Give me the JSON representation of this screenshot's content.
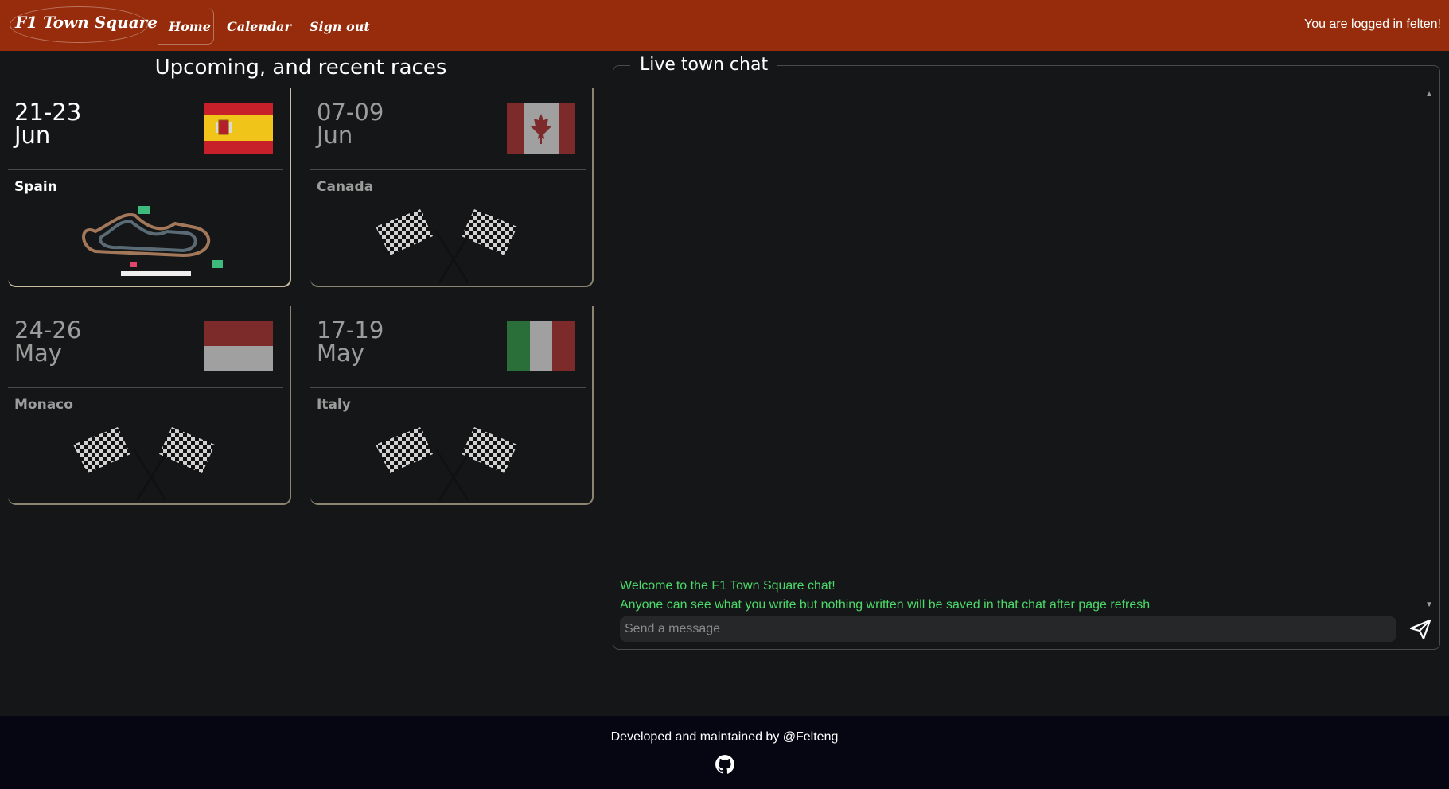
{
  "header": {
    "logo": "F1 Town Square",
    "nav": [
      {
        "label": "Home"
      },
      {
        "label": "Calendar"
      },
      {
        "label": "Sign out"
      }
    ],
    "login_status": "You are logged in felten!"
  },
  "races": {
    "title": "Upcoming, and recent races",
    "cards": [
      {
        "dates": "21-23",
        "month": "Jun",
        "country": "Spain",
        "flag_icon": "spain-flag-icon",
        "image": "circuit-map-icon",
        "highlighted": true
      },
      {
        "dates": "07-09",
        "month": "Jun",
        "country": "Canada",
        "flag_icon": "canada-flag-icon",
        "image": "checkered-flags-icon",
        "highlighted": false
      },
      {
        "dates": "24-26",
        "month": "May",
        "country": "Monaco",
        "flag_icon": "monaco-flag-icon",
        "image": "checkered-flags-icon",
        "highlighted": false
      },
      {
        "dates": "17-19",
        "month": "May",
        "country": "Italy",
        "flag_icon": "italy-flag-icon",
        "image": "checkered-flags-icon",
        "highlighted": false
      }
    ]
  },
  "chat": {
    "title": "Live town chat",
    "messages": [
      "Welcome to the F1 Town Square chat!",
      "Anyone can see what you write but nothing written will be saved in that chat after page refresh"
    ],
    "input_placeholder": "Send a message",
    "send_icon": "send-icon"
  },
  "footer": {
    "text": "Developed and maintained by @Felteng",
    "icon": "github-icon"
  },
  "colors": {
    "header_bg": "#962c0b",
    "page_bg": "#151617",
    "footer_bg": "#050612",
    "chat_text": "#4cd96a",
    "card_border": "#8c8370"
  }
}
